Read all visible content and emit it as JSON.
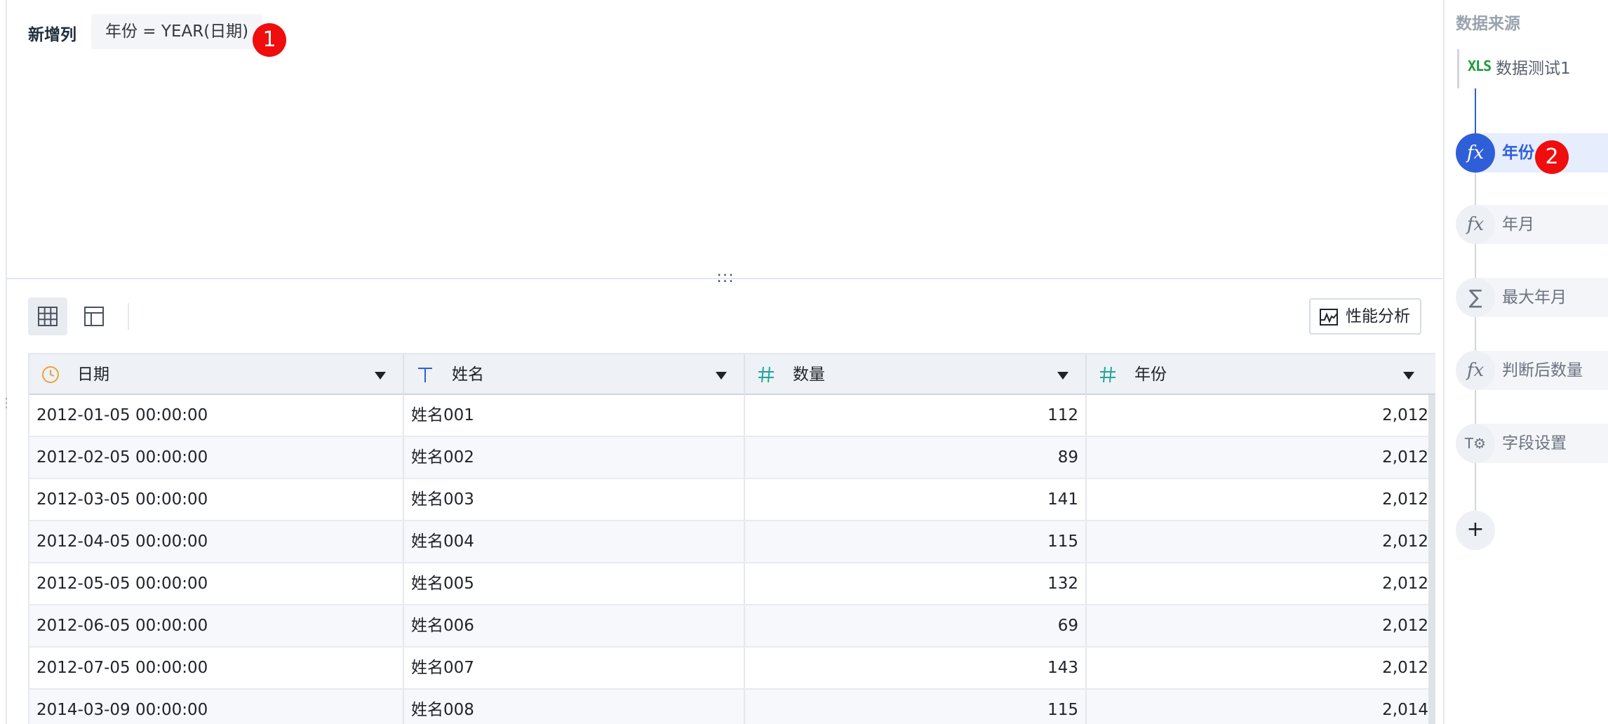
{
  "editor": {
    "label": "新增列",
    "formula": "年份 = YEAR(日期)",
    "splitter_glyph": ":::"
  },
  "markers": {
    "first": "1",
    "second": "2"
  },
  "toolbar": {
    "grid_view_icon": "grid-icon",
    "layout_view_icon": "layout-icon",
    "perf_button_label": "性能分析",
    "perf_icon": "chart-pulse-icon"
  },
  "table": {
    "columns": [
      {
        "label": "日期",
        "type_icon": "clock-icon",
        "color": "#e8a33a"
      },
      {
        "label": "姓名",
        "type_icon": "text-type-icon",
        "color": "#2f5fd8"
      },
      {
        "label": "数量",
        "type_icon": "hash-icon",
        "color": "#22a699"
      },
      {
        "label": "年份",
        "type_icon": "hash-icon",
        "color": "#22a699"
      }
    ],
    "rows": [
      [
        "2012-01-05 00:00:00",
        "姓名001",
        "112",
        "2,012"
      ],
      [
        "2012-02-05 00:00:00",
        "姓名002",
        "89",
        "2,012"
      ],
      [
        "2012-03-05 00:00:00",
        "姓名003",
        "141",
        "2,012"
      ],
      [
        "2012-04-05 00:00:00",
        "姓名004",
        "115",
        "2,012"
      ],
      [
        "2012-05-05 00:00:00",
        "姓名005",
        "132",
        "2,012"
      ],
      [
        "2012-06-05 00:00:00",
        "姓名006",
        "69",
        "2,012"
      ],
      [
        "2012-07-05 00:00:00",
        "姓名007",
        "143",
        "2,012"
      ],
      [
        "2014-03-09 00:00:00",
        "姓名008",
        "115",
        "2,014"
      ]
    ]
  },
  "pipeline": {
    "title": "数据来源",
    "source": {
      "icon": "XLS",
      "name": "数据测试1"
    },
    "steps": [
      {
        "label": "年份",
        "icon": "fx-icon",
        "glyph": "fx",
        "active": true
      },
      {
        "label": "年月",
        "icon": "fx-icon",
        "glyph": "fx",
        "active": false
      },
      {
        "label": "最大年月",
        "icon": "sigma-icon",
        "glyph": "∑",
        "active": false
      },
      {
        "label": "判断后数量",
        "icon": "fx-icon",
        "glyph": "fx",
        "active": false
      },
      {
        "label": "字段设置",
        "icon": "field-settings-icon",
        "glyph": "T⚙",
        "active": false
      }
    ],
    "add_label": "+"
  },
  "colors": {
    "accent": "#2f5fd8",
    "marker_red": "#f00d0d",
    "xls_green": "#1f9d3c"
  }
}
